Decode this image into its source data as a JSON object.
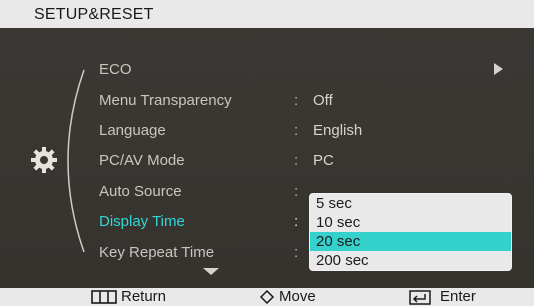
{
  "window": {
    "title": "SETUP&RESET"
  },
  "icons": {
    "menu_icon": "gear-icon",
    "submenu_arrow": "right-triangle-icon",
    "scroll_more": "down-triangle-icon"
  },
  "colors": {
    "highlight": "#33d6d2",
    "selected_option_bg": "#34d1cd",
    "background": "#3a3733"
  },
  "menu": {
    "items": [
      {
        "label": "ECO",
        "has_submenu": true
      },
      {
        "label": "Menu Transparency",
        "value": "Off"
      },
      {
        "label": "Language",
        "value": "English"
      },
      {
        "label": "PC/AV Mode",
        "value": "PC"
      },
      {
        "label": "Auto Source",
        "value": ""
      },
      {
        "label": "Display Time",
        "value": "",
        "active": true
      },
      {
        "label": "Key Repeat Time",
        "value": ""
      }
    ]
  },
  "dropdown": {
    "options": [
      "5 sec",
      "10 sec",
      "20 sec",
      "200 sec"
    ],
    "selected": "20 sec"
  },
  "footer": {
    "return_label": "Return",
    "move_label": "Move",
    "enter_label": "Enter"
  }
}
